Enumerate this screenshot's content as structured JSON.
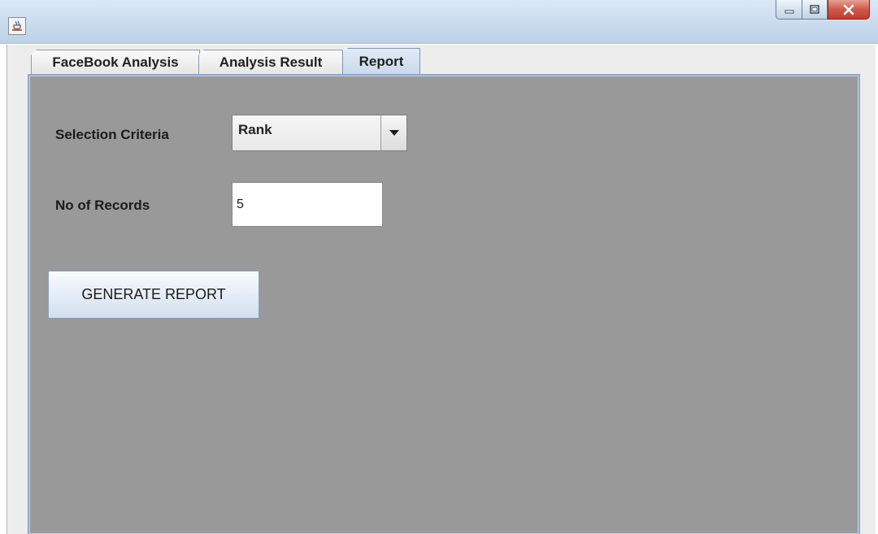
{
  "window": {
    "icon": "java-app-icon",
    "controls": [
      "minimize-icon",
      "maximize-icon",
      "close-icon"
    ]
  },
  "tabs": [
    {
      "label": "FaceBook Analysis",
      "active": false
    },
    {
      "label": "Analysis Result",
      "active": false
    },
    {
      "label": "Report",
      "active": true
    }
  ],
  "form": {
    "selection_criteria_label": "Selection Criteria",
    "selection_criteria_value": "Rank",
    "records_label": "No of Records",
    "records_value": "5",
    "generate_button": "GENERATE REPORT"
  },
  "colors": {
    "panel_background": "#999999",
    "close_button": "#c8463a"
  }
}
